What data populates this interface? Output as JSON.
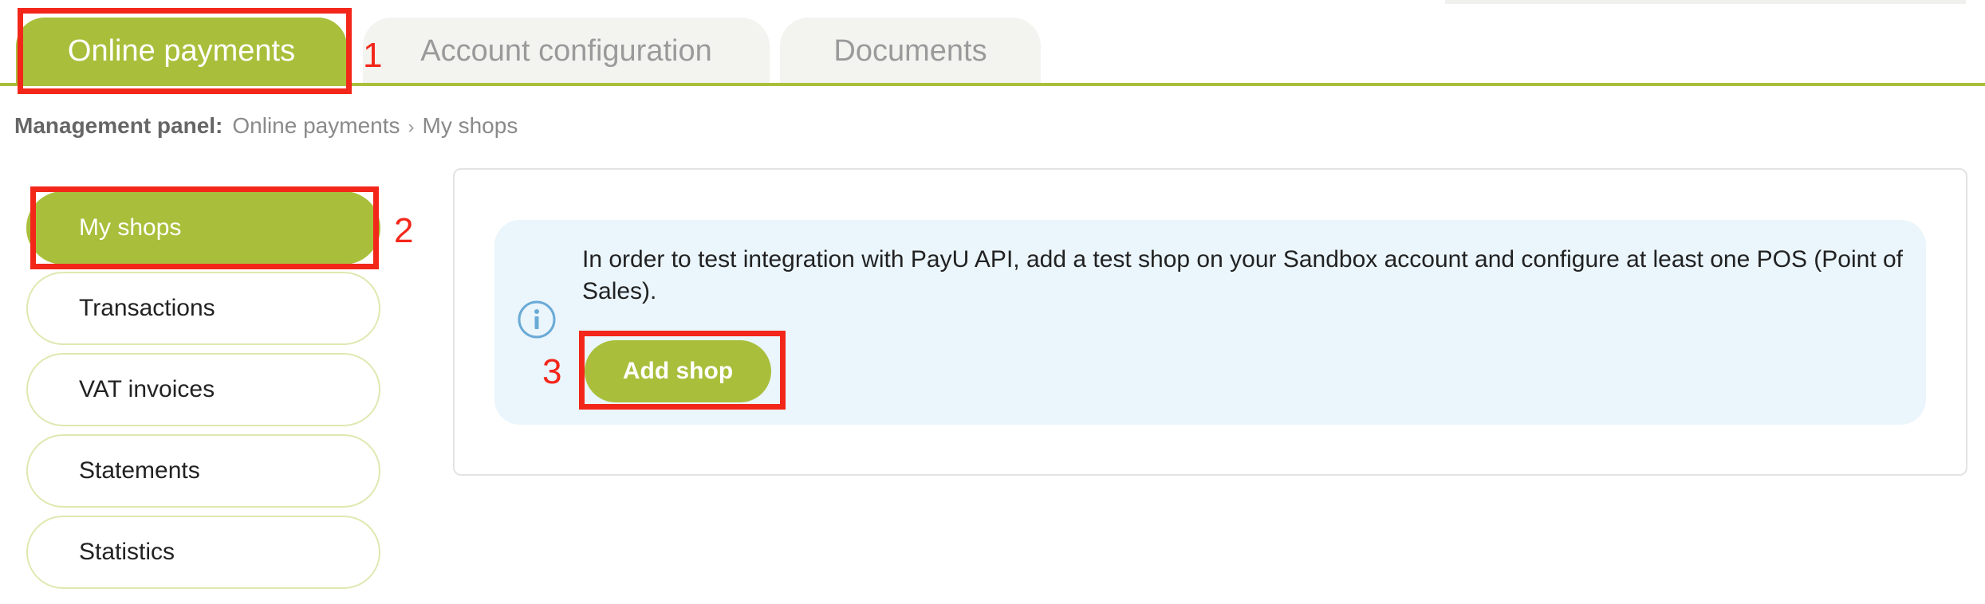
{
  "tabs": [
    {
      "label": "Online payments",
      "active": true
    },
    {
      "label": "Account configuration",
      "active": false
    },
    {
      "label": "Documents",
      "active": false
    }
  ],
  "breadcrumb": {
    "label": "Management panel:",
    "items": [
      "Online payments",
      "My shops"
    ],
    "separator": "›"
  },
  "sidebar": {
    "items": [
      {
        "label": "My shops",
        "active": true
      },
      {
        "label": "Transactions",
        "active": false
      },
      {
        "label": "VAT invoices",
        "active": false
      },
      {
        "label": "Statements",
        "active": false
      },
      {
        "label": "Statistics",
        "active": false
      }
    ]
  },
  "main": {
    "info_icon": "info-circle-icon",
    "info_text": "In order to test integration with PayU API, add a test shop on your Sandbox account and configure at least one POS (Point of Sales).",
    "add_shop_label": "Add shop"
  },
  "annotations": {
    "numbers": [
      "1",
      "2",
      "3"
    ]
  },
  "colors": {
    "accent": "#a9bf3b",
    "annotation": "#f3261a",
    "info_bg": "#eaf5fc",
    "info_icon": "#6aaad6"
  }
}
